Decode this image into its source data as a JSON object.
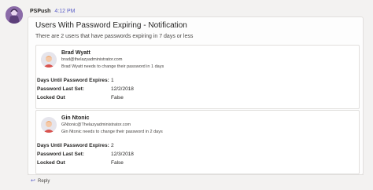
{
  "message": {
    "sender": "PSPush",
    "time": "4:12 PM",
    "bot_avatar_color": "#8b6ba8"
  },
  "card": {
    "title": "Users With Password Expiring - Notification",
    "subtitle": "There are 2 users that have passwords expiring in 7 days or less"
  },
  "fact_labels": {
    "days_until": "Days Until Password Expires:",
    "last_set": "Password Last Set:",
    "locked_out": "Locked Out"
  },
  "users": [
    {
      "name": "Brad Wyatt",
      "email": "brad@thelazyadministrator.com",
      "note": "Brad Wyatt needs to change their password in 1 days",
      "days_until": "1",
      "last_set": "12/2/2018",
      "locked_out": "False"
    },
    {
      "name": "Gin Ntonic",
      "email": "GNtonic@Thelazyadministrator.com",
      "note": "Gin Ntonic needs to change their password in 2 days",
      "days_until": "2",
      "last_set": "12/3/2018",
      "locked_out": "False"
    }
  ],
  "reply": {
    "icon": "reply-arrow-icon",
    "label": "Reply"
  },
  "colors": {
    "accent": "#5b5fc7",
    "background": "#f3f2f1",
    "card": "#ffffff",
    "border": "#e1dfdd"
  }
}
